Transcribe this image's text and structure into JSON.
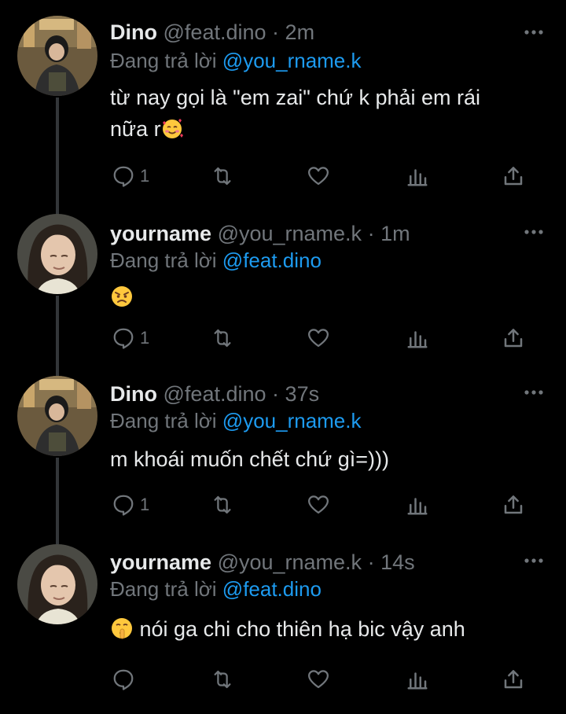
{
  "tweets": [
    {
      "name": "Dino",
      "handle": "@feat.dino",
      "separator": "·",
      "time": "2m",
      "reply_prefix": "Đang trả lời",
      "reply_to": "@you_rname.k",
      "text_line1": "từ nay gọi là \"em zai\" chứ k phải em rái",
      "text_line2": "nữa r",
      "emoji": "smiling-face-with-hearts",
      "reply_count": "1",
      "avatar": "dino-avatar"
    },
    {
      "name": "yourname",
      "handle": "@you_rname.k",
      "separator": "·",
      "time": "1m",
      "reply_prefix": "Đang trả lời",
      "reply_to": "@feat.dino",
      "emoji": "angry-face",
      "reply_count": "1",
      "avatar": "yourname-avatar"
    },
    {
      "name": "Dino",
      "handle": "@feat.dino",
      "separator": "·",
      "time": "37s",
      "reply_prefix": "Đang trả lời",
      "reply_to": "@you_rname.k",
      "text_line1": "m khoái muốn chết chứ gì=)))",
      "reply_count": "1",
      "avatar": "dino-avatar"
    },
    {
      "name": "yourname",
      "handle": "@you_rname.k",
      "separator": "·",
      "time": "14s",
      "reply_prefix": "Đang trả lời",
      "reply_to": "@feat.dino",
      "emoji": "shushing-face",
      "text_line1": "nói ga chi cho thiên hạ bic vậy anh",
      "reply_count": "",
      "avatar": "yourname-avatar"
    }
  ],
  "colors": {
    "background": "#000000",
    "text": "#e7e9ea",
    "muted": "#71767b",
    "mention": "#1d9bf0",
    "thread_line": "#333639"
  }
}
